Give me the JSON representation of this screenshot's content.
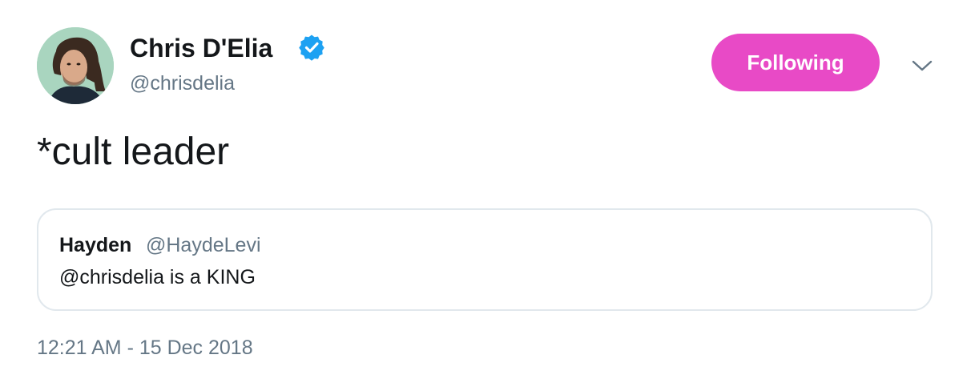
{
  "tweet": {
    "author": {
      "name": "Chris D'Elia",
      "handle": "@chrisdelia",
      "verified": true,
      "avatar_icon": "profile-photo"
    },
    "follow_button_label": "Following",
    "menu_icon": "chevron-down-icon",
    "text": "*cult leader",
    "quoted_tweet": {
      "author_name": "Hayden",
      "author_handle": "@HaydeLevi",
      "text": "@chrisdelia is a KING"
    },
    "timestamp": "12:21 AM - 15 Dec 2018"
  },
  "colors": {
    "follow_button": "#e84ac6",
    "verified_badge": "#1da1f2",
    "secondary_text": "#657786",
    "border": "#e1e8ed"
  }
}
